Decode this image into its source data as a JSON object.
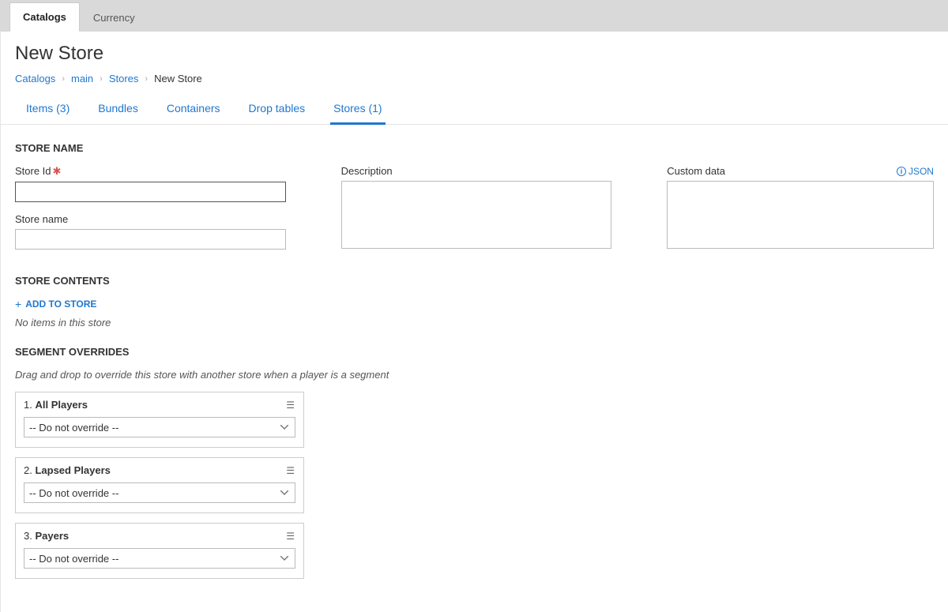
{
  "topTabs": {
    "catalogs": "Catalogs",
    "currency": "Currency"
  },
  "pageTitle": "New Store",
  "breadcrumb": {
    "catalogs": "Catalogs",
    "main": "main",
    "stores": "Stores",
    "current": "New Store"
  },
  "subTabs": {
    "items": "Items (3)",
    "bundles": "Bundles",
    "containers": "Containers",
    "dropTables": "Drop tables",
    "stores": "Stores (1)"
  },
  "sections": {
    "storeName": "STORE NAME",
    "storeContents": "STORE CONTENTS",
    "segmentOverrides": "SEGMENT OVERRIDES"
  },
  "labels": {
    "storeId": "Store Id",
    "storeName": "Store name",
    "description": "Description",
    "customData": "Custom data",
    "json": "JSON"
  },
  "actions": {
    "addToStore": "ADD TO STORE"
  },
  "notes": {
    "noItems": "No items in this store",
    "segmentHint": "Drag and drop to override this store with another store when a player is a segment"
  },
  "segments": [
    {
      "index": "1.",
      "name": "All Players",
      "value": "-- Do not override --"
    },
    {
      "index": "2.",
      "name": "Lapsed Players",
      "value": "-- Do not override --"
    },
    {
      "index": "3.",
      "name": "Payers",
      "value": "-- Do not override --"
    }
  ],
  "fields": {
    "storeId": "",
    "storeName": "",
    "description": "",
    "customData": ""
  }
}
